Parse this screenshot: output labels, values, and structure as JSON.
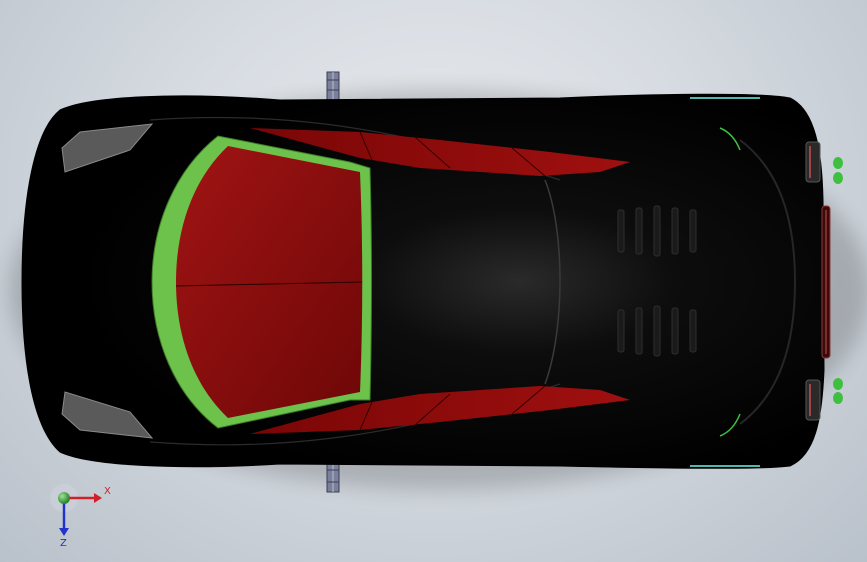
{
  "viewport": {
    "background_top": "#e9ecf0",
    "background_bottom": "#b9c1ca"
  },
  "model": {
    "description_icon": "car-top-view",
    "body_color": "#050505",
    "glass_color": "#8b0a0a",
    "windshield_frame_color": "#6cc24a",
    "accent_green": "#3fbf3f",
    "axle_color": "#7a7f9a"
  },
  "triad": {
    "x_label": "X",
    "z_label": "Z",
    "x_color": "#d0202a",
    "y_color": "#2fa82f",
    "z_color": "#2233cc"
  }
}
